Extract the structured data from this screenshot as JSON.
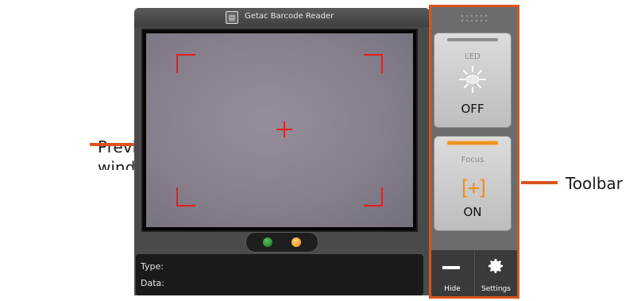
{
  "annotations": {
    "preview_label_line1": "Preview",
    "preview_label_line2": "window",
    "toolbar_label": "Toolbar"
  },
  "window": {
    "title": "Getac Barcode Reader",
    "title_icon": "barcode-reader-app-icon"
  },
  "indicators": {
    "left_color": "#2e8b34",
    "right_color": "#f08a10"
  },
  "info": {
    "type_label": "Type:",
    "data_label": "Data:"
  },
  "toolbar": {
    "led": {
      "label": "LED",
      "state": "OFF",
      "icon": "led-light-icon"
    },
    "focus": {
      "label": "Focus",
      "state": "ON",
      "icon": "focus-bracket-icon",
      "glyph": "[+]"
    },
    "hide_label": "Hide",
    "settings_label": "Settings"
  },
  "colors": {
    "accent": "#d9541e",
    "reticle": "#e31f1f",
    "active": "#f0901c"
  }
}
